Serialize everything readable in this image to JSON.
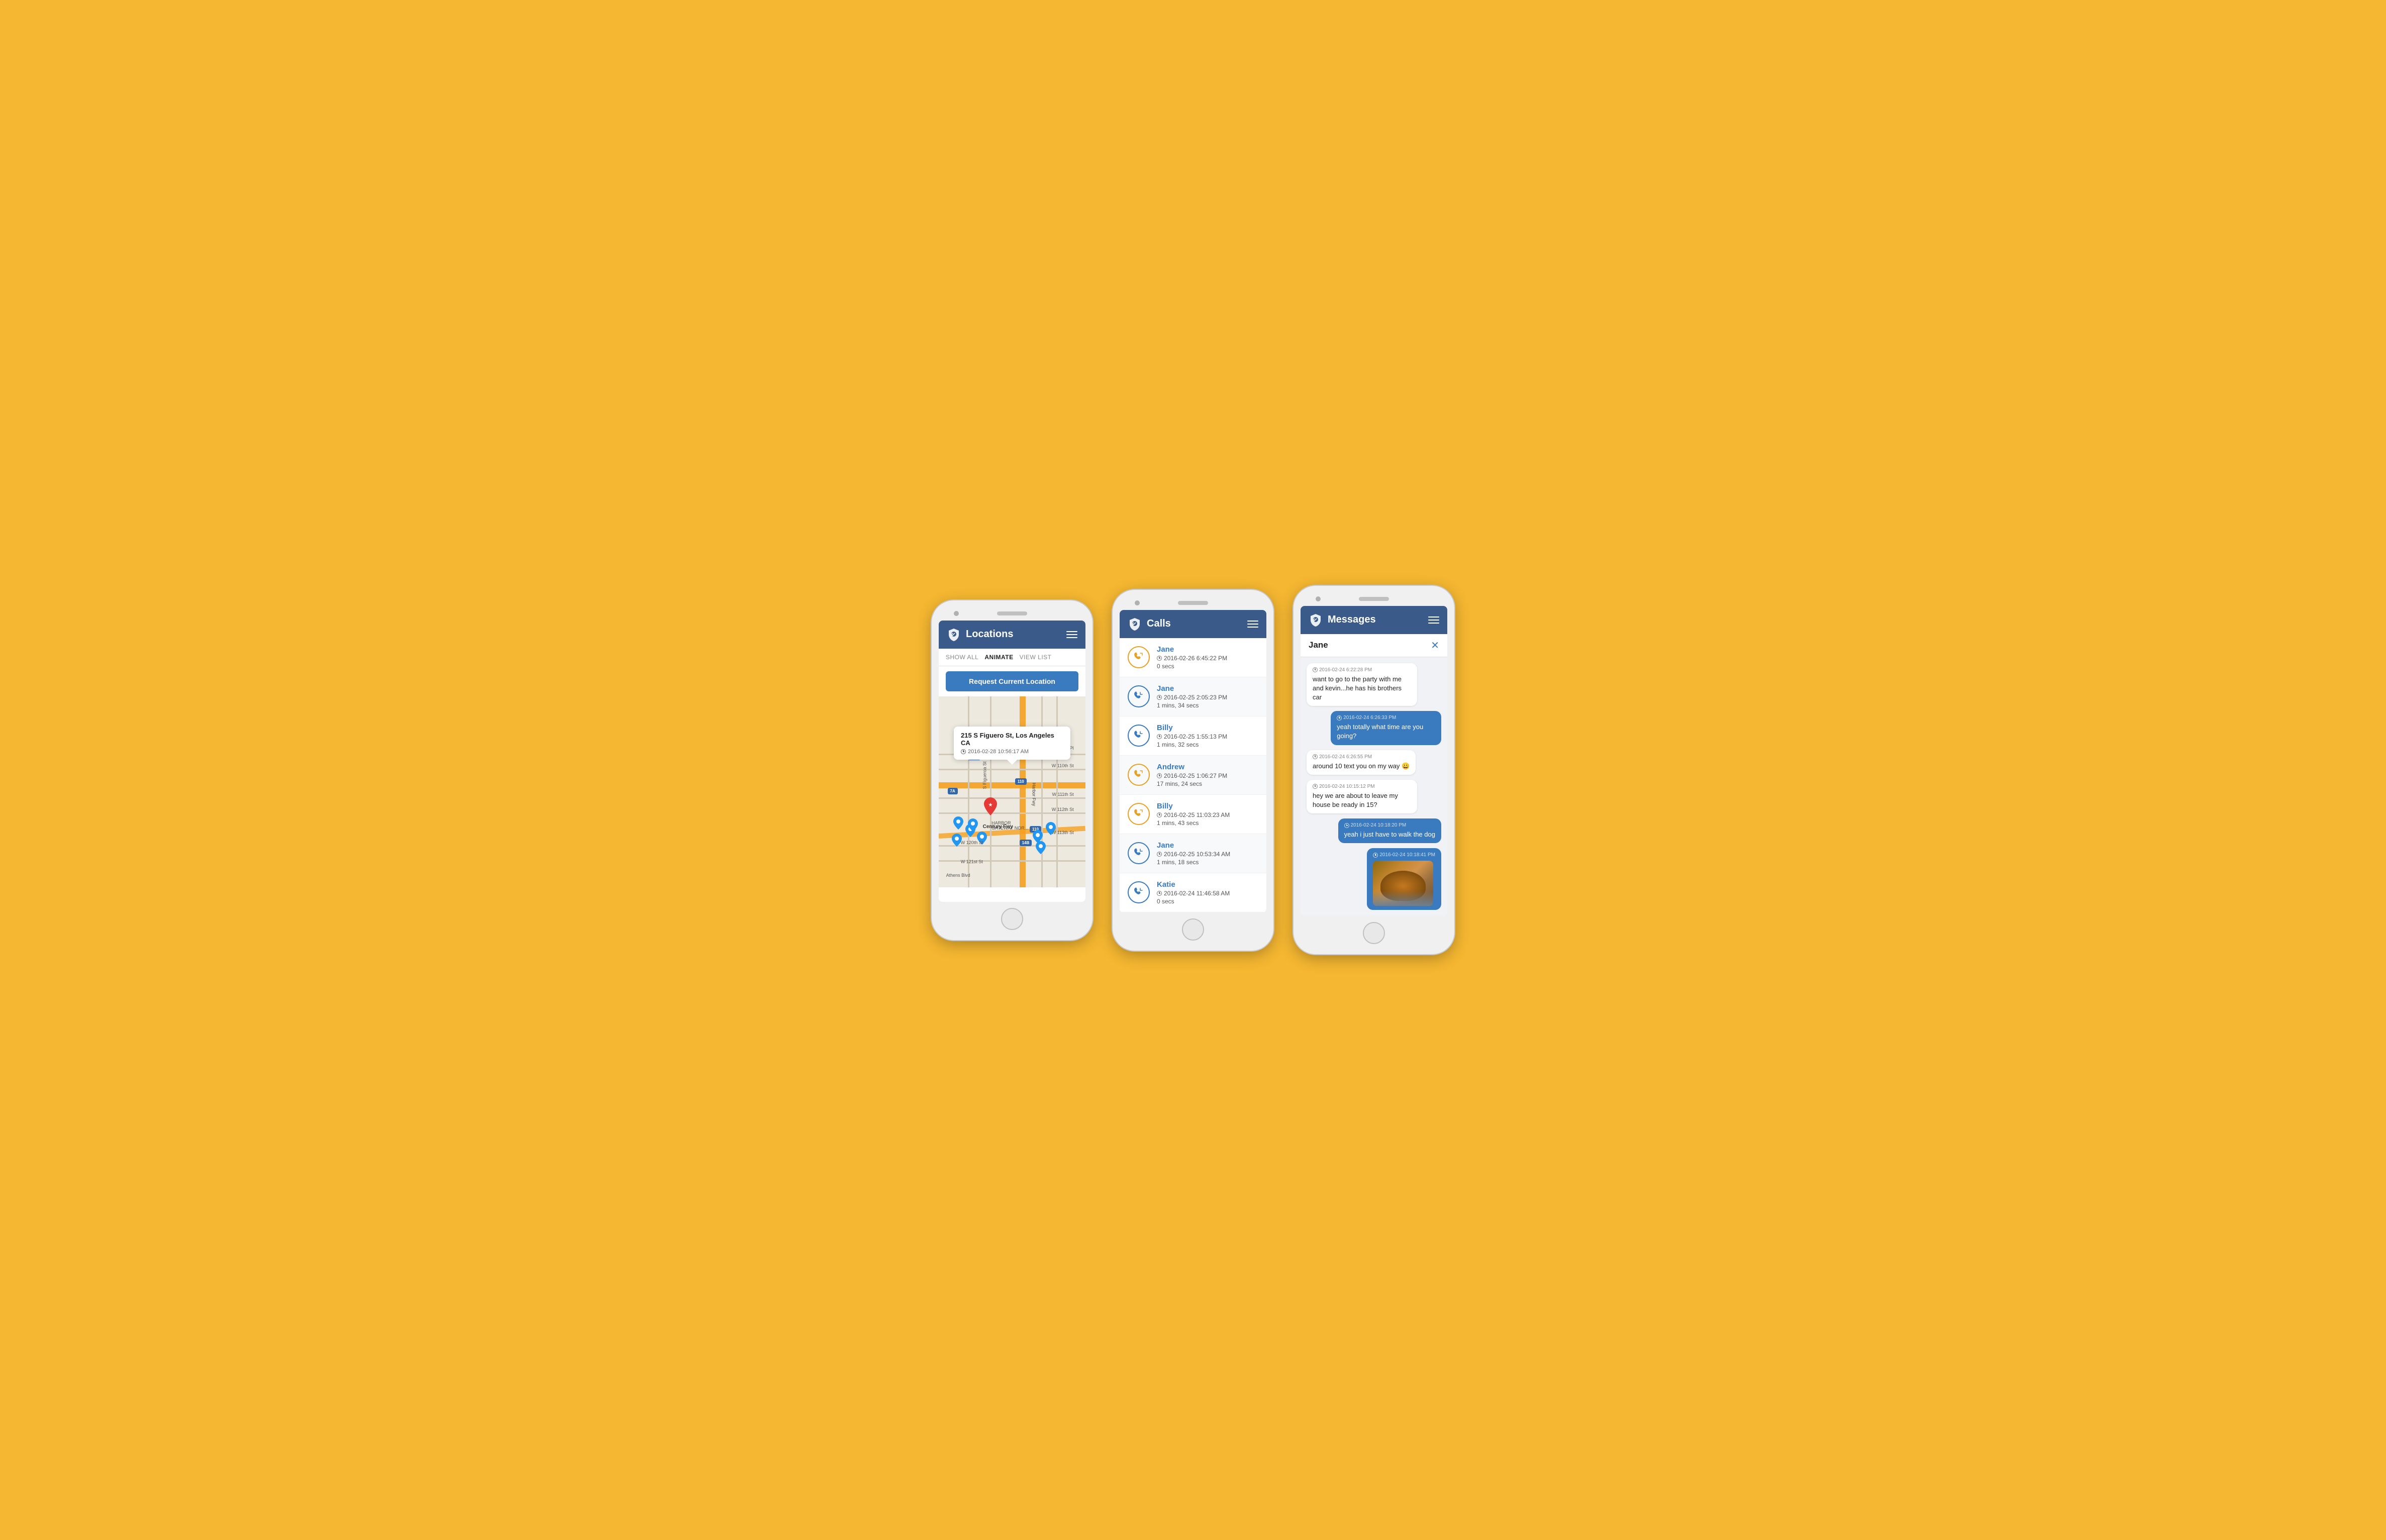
{
  "phone1": {
    "header": {
      "title": "Locations",
      "menu_label": "menu"
    },
    "toolbar": {
      "show_all": "SHOW ALL",
      "animate": "ANIMATE",
      "view_list": "VIEW LIST",
      "active": "ANIMATE"
    },
    "request_btn": "Request Current Location",
    "map_popup": {
      "address": "215 S Figuero St, Los Angeles CA",
      "time": "2016-02-28 10:56:17 AM"
    }
  },
  "phone2": {
    "header": {
      "title": "Calls"
    },
    "calls": [
      {
        "name": "Jane",
        "time": "2016-02-26 6:45:22 PM",
        "duration": "0 secs",
        "type": "outgoing"
      },
      {
        "name": "Jane",
        "time": "2016-02-25 2:05:23 PM",
        "duration": "1 mins, 34 secs",
        "type": "incoming"
      },
      {
        "name": "Billy",
        "time": "2016-02-25 1:55:13 PM",
        "duration": "1 mins, 32 secs",
        "type": "incoming"
      },
      {
        "name": "Andrew",
        "time": "2016-02-25 1:06:27 PM",
        "duration": "17 mins, 24 secs",
        "type": "outgoing"
      },
      {
        "name": "Billy",
        "time": "2016-02-25 11:03:23 AM",
        "duration": "1 mins, 43 secs",
        "type": "outgoing"
      },
      {
        "name": "Jane",
        "time": "2016-02-25 10:53:34 AM",
        "duration": "1 mins, 18 secs",
        "type": "incoming"
      },
      {
        "name": "Katie",
        "time": "2016-02-24 11:46:58 AM",
        "duration": "0 secs",
        "type": "incoming"
      }
    ]
  },
  "phone3": {
    "header": {
      "title": "Messages"
    },
    "contact": "Jane",
    "messages": [
      {
        "side": "received",
        "time": "2016-02-24 6:22:28 PM",
        "text": "want to go to the party with me and kevin...he has his brothers car",
        "has_image": false
      },
      {
        "side": "sent",
        "time": "2016-02-24 6:26:33 PM",
        "text": "yeah totally what time are you going?",
        "has_image": false
      },
      {
        "side": "received",
        "time": "2016-02-24 6:26:55 PM",
        "text": "around 10 text you on my way 😀",
        "has_image": false
      },
      {
        "side": "received",
        "time": "2016-02-24 10:15:12 PM",
        "text": "hey we are about to leave my house be ready in 15?",
        "has_image": false
      },
      {
        "side": "sent",
        "time": "2016-02-24 10:18:20 PM",
        "text": "yeah i just have to walk the dog",
        "has_image": false
      },
      {
        "side": "sent",
        "time": "2016-02-24 10:18:41 PM",
        "text": "",
        "has_image": true
      }
    ]
  }
}
